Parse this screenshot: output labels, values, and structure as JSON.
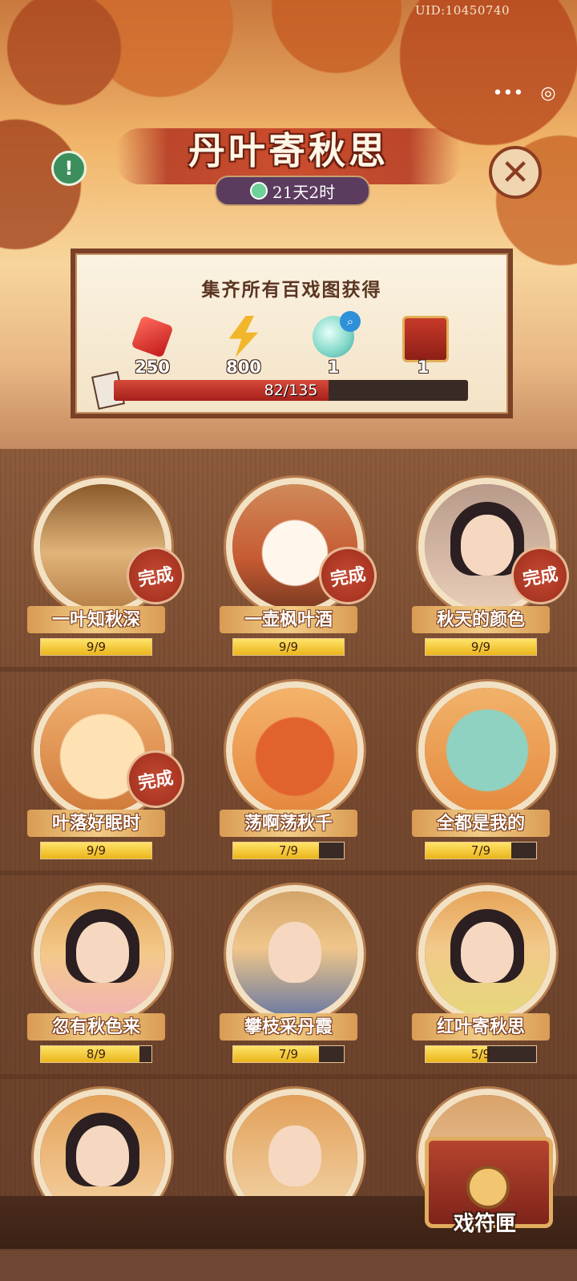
{
  "status": {
    "uid": "UID:10450740"
  },
  "mini_program": {
    "more_glyph": "•••",
    "close_glyph": "◎"
  },
  "event": {
    "title": "丹叶寄秋思",
    "timer": "21天2时"
  },
  "collection": {
    "heading": "集齐所有百戏图获得",
    "rewards": [
      {
        "icon": "ruby-icon",
        "qty": "250"
      },
      {
        "icon": "energy-bolt-icon",
        "qty": "800"
      },
      {
        "icon": "jade-orb-icon",
        "qty": "1"
      },
      {
        "icon": "mystery-chest-icon",
        "qty": "1"
      }
    ],
    "progress_text": "82/135",
    "progress_fraction": 0.607
  },
  "items": [
    {
      "name": "一叶知秋深",
      "progress": "9/9",
      "fraction": 1.0,
      "done": "完成"
    },
    {
      "name": "一壶枫叶酒",
      "progress": "9/9",
      "fraction": 1.0,
      "done": "完成"
    },
    {
      "name": "秋天的颜色",
      "progress": "9/9",
      "fraction": 1.0,
      "done": "完成"
    },
    {
      "name": "叶落好眠时",
      "progress": "9/9",
      "fraction": 1.0,
      "done": "完成"
    },
    {
      "name": "荡啊荡秋千",
      "progress": "7/9",
      "fraction": 0.778
    },
    {
      "name": "全都是我的",
      "progress": "7/9",
      "fraction": 0.778
    },
    {
      "name": "忽有秋色来",
      "progress": "8/9",
      "fraction": 0.889
    },
    {
      "name": "攀枝采丹霞",
      "progress": "7/9",
      "fraction": 0.778
    },
    {
      "name": "红叶寄秋思",
      "progress": "5/9",
      "fraction": 0.556
    }
  ],
  "chest_button": {
    "label": "戏符匣"
  },
  "colors": {
    "accent_red": "#c43a22",
    "bar_yellow": "#e9b51a",
    "wood": "#6e4631"
  }
}
